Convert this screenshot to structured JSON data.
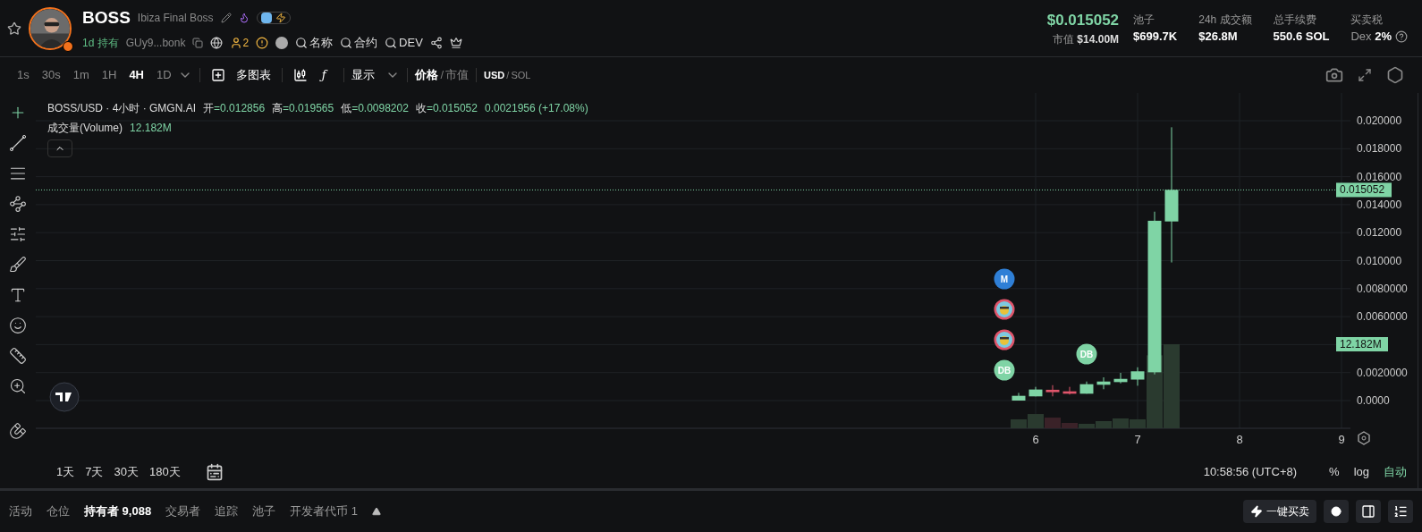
{
  "token": {
    "symbol": "BOSS",
    "name": "Ibiza Final Boss",
    "age": "1d",
    "holding_label": "持有",
    "address": "GUy9...bonk",
    "holders_badge": "2",
    "search_links": [
      "名称",
      "合约",
      "DEV"
    ]
  },
  "stats": {
    "price": "$0.015052",
    "mcap_label": "市值",
    "mcap": "$14.00M",
    "items": [
      {
        "label": "池子",
        "value": "$699.7K"
      },
      {
        "label": "24h 成交额",
        "value": "$26.8M"
      },
      {
        "label": "总手续费",
        "value": "550.6 SOL"
      }
    ],
    "tax_label": "买卖税",
    "tax_prefix": "Dex",
    "tax": "2%"
  },
  "intervals": [
    {
      "label": "1s",
      "selected": false
    },
    {
      "label": "30s",
      "selected": false
    },
    {
      "label": "1m",
      "selected": false
    },
    {
      "label": "1H",
      "selected": false
    },
    {
      "label": "4H",
      "selected": true
    },
    {
      "label": "1D",
      "selected": false
    }
  ],
  "toolbar": {
    "multi_chart": "多图表",
    "indicator_glyph": "ƒ",
    "display": "显示",
    "separator": "/",
    "price_mode": [
      {
        "label": "价格",
        "selected": true
      },
      {
        "label": "市值",
        "selected": false
      }
    ],
    "currency": [
      {
        "label": "USD",
        "selected": true
      },
      {
        "label": "SOL",
        "selected": false
      }
    ]
  },
  "legend": {
    "title": "BOSS/USD · 4小时 · GMGN.AI",
    "ohlc": [
      {
        "label": "开",
        "value": "=0.012856"
      },
      {
        "label": "高",
        "value": "=0.019565"
      },
      {
        "label": "低",
        "value": "=0.0098202"
      },
      {
        "label": "收",
        "value": "=0.015052"
      }
    ],
    "change": "0.0021956 (+17.08%)",
    "volume_label": "成交量(Volume)",
    "volume_value": "12.182M"
  },
  "chart": {
    "price_tag": "0.015052",
    "volume_tag": "12.182M",
    "price_axis": [
      "0.020000",
      "0.018000",
      "0.016000",
      "0.014000",
      "0.012000",
      "0.010000",
      "0.0080000",
      "0.0060000",
      "0.0020000",
      "0.0000"
    ],
    "time_axis": [
      "6",
      "7",
      "8",
      "9"
    ],
    "markers": [
      {
        "kind": "letter",
        "label": "M",
        "color": "#2f7fd6"
      },
      {
        "kind": "picture",
        "color": "#e0556b"
      },
      {
        "kind": "picture",
        "color": "#e0556b"
      },
      {
        "kind": "letter",
        "label": "DB",
        "color": "#7fd4a5"
      }
    ],
    "trade_marker": {
      "label": "DB",
      "color": "#7fd4a5"
    }
  },
  "ranges": [
    "1天",
    "7天",
    "30天",
    "180天"
  ],
  "clock": "10:58:56 (UTC+8)",
  "scale_options": [
    {
      "label": "%",
      "selected": false
    },
    {
      "label": "log",
      "selected": false
    },
    {
      "label": "自动",
      "selected": true
    }
  ],
  "bottom_tabs": [
    {
      "label": "活动",
      "selected": false
    },
    {
      "label": "仓位",
      "selected": false
    },
    {
      "label": "持有者 9,088",
      "selected": true
    },
    {
      "label": "交易者",
      "selected": false
    },
    {
      "label": "追踪",
      "selected": false
    },
    {
      "label": "池子",
      "selected": false
    },
    {
      "label": "开发者代币 1",
      "selected": false
    }
  ],
  "quick_trade": "一键买卖"
}
